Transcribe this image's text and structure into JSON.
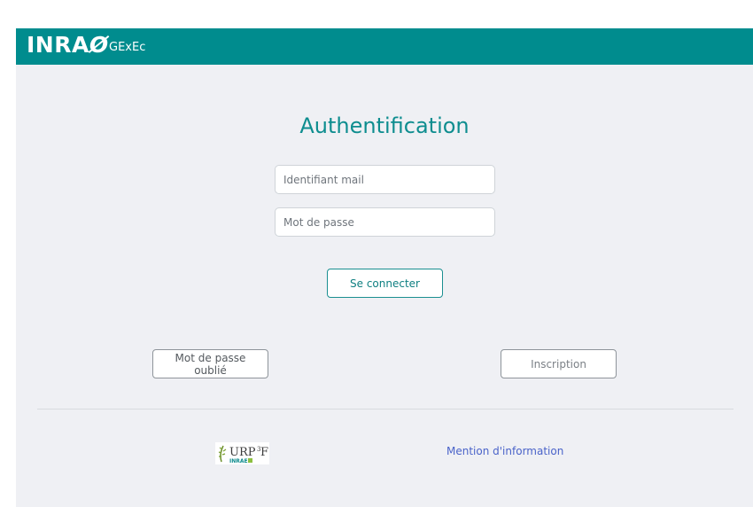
{
  "header": {
    "logo_text": "INRAE",
    "logo_mark": "INRAØ",
    "app_name": "GExEc",
    "background_color": "#008c8e"
  },
  "login": {
    "title": "Authentification",
    "email_placeholder": "Identifiant mail",
    "password_placeholder": "Mot de passe",
    "submit_label": "Se connecter"
  },
  "actions": {
    "forgot_label": "Mot de passe oublié",
    "signup_label": "Inscription"
  },
  "footer": {
    "partner_logo_text": "URP3F",
    "partner_logo_subtext": "INRAE",
    "mention_label": "Mention d'information",
    "link_color": "#4a63c9"
  }
}
